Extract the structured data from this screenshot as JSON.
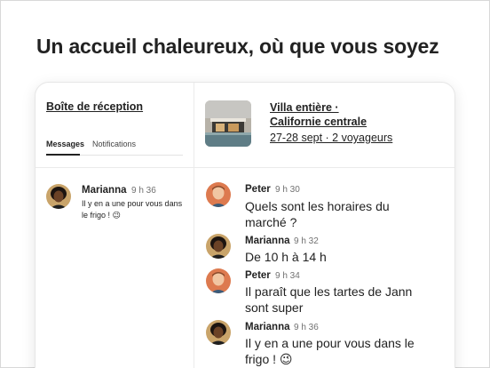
{
  "headline": "Un accueil chaleureux, où que vous soyez",
  "inbox": {
    "title": "Boîte de réception",
    "tabs": [
      {
        "label": "Messages",
        "active": true
      },
      {
        "label": "Notifications",
        "active": false
      }
    ],
    "items": [
      {
        "name": "Marianna",
        "time": "9 h 36",
        "preview": "Il y en a une pour vous dans le frigo ! 😉"
      }
    ]
  },
  "listing": {
    "title": "Villa entière · Californie centrale",
    "dates": "27-28 sept · 2 voyageurs"
  },
  "messages": [
    {
      "sender": "Peter",
      "time": "9 h 30",
      "text": "Quels sont les horaires du marché ?"
    },
    {
      "sender": "Marianna",
      "time": "9 h 32",
      "text": "De 10 h à 14 h"
    },
    {
      "sender": "Peter",
      "time": "9 h 34",
      "text": "Il paraît que les tartes de Jann sont super"
    },
    {
      "sender": "Marianna",
      "time": "9 h 36",
      "text": "Il y en a une pour vous dans le frigo ! 😉"
    }
  ],
  "colors": {
    "text": "#222222",
    "muted": "#717171",
    "divider": "#ebebeb"
  }
}
